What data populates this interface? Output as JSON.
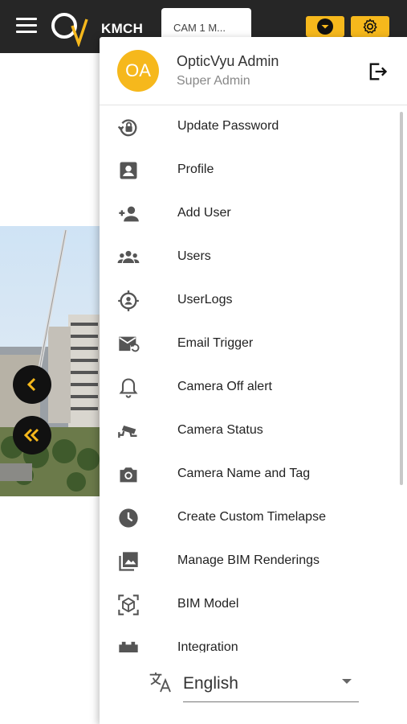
{
  "header": {
    "org_label": "KMCH",
    "camera_tab": "CAM 1 M...",
    "accent": "#f6b81c",
    "bar_color": "#262626",
    "icons": [
      "hamburger-icon",
      "logo-icon",
      "chevron-down-icon",
      "gear-icon"
    ]
  },
  "nav": {
    "prev_icon": "chevron-left-icon",
    "rewind_icon": "double-chevron-left-icon"
  },
  "user": {
    "initials": "OA",
    "name": "OpticVyu Admin",
    "role": "Super Admin",
    "logout_icon": "logout-icon"
  },
  "menu": {
    "items": [
      {
        "label": "Update Password",
        "icon": "lock-reset-icon"
      },
      {
        "label": "Profile",
        "icon": "account-box-icon"
      },
      {
        "label": "Add User",
        "icon": "add-user-icon"
      },
      {
        "label": "Users",
        "icon": "users-icon"
      },
      {
        "label": "UserLogs",
        "icon": "user-target-icon"
      },
      {
        "label": "Email Trigger",
        "icon": "email-sync-icon"
      },
      {
        "label": "Camera Off alert",
        "icon": "bell-icon"
      },
      {
        "label": "Camera Status",
        "icon": "cctv-icon"
      },
      {
        "label": "Camera Name and Tag",
        "icon": "camera-icon"
      },
      {
        "label": "Create Custom Timelapse",
        "icon": "clock-icon"
      },
      {
        "label": "Manage BIM Renderings",
        "icon": "image-multiple-icon"
      },
      {
        "label": "BIM Model",
        "icon": "cube-scan-icon"
      },
      {
        "label": "Integration",
        "icon": "integration-icon"
      }
    ]
  },
  "language": {
    "selected": "English",
    "icon": "translate-icon"
  }
}
